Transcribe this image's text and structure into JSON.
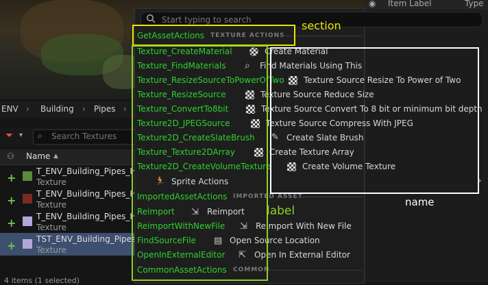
{
  "right_panel": {
    "col1": "Item Label",
    "col2": "Type"
  },
  "breadcrumb": {
    "env": "ENV",
    "sep": "›",
    "building": "Building",
    "pipes": "Pipes"
  },
  "toolbar": {
    "search_placeholder": "Search Textures"
  },
  "column_header": {
    "name": "Name",
    "sort": "▲"
  },
  "assets": [
    {
      "name": "T_ENV_Building_Pipes_Hole",
      "type": "Texture",
      "thumb": "#5a8a3a"
    },
    {
      "name": "T_ENV_Building_Pipes_Hole",
      "type": "Texture",
      "thumb": "#7a2a22"
    },
    {
      "name": "T_ENV_Building_Pipes_Hole",
      "type": "Texture",
      "thumb": "#b0a8d8"
    },
    {
      "name": "TST_ENV_Building_Pipes_",
      "type": "Texture",
      "thumb": "#b0a8d8"
    }
  ],
  "footer": {
    "status": "4 items (1 selected)"
  },
  "menu": {
    "search_placeholder": "Start typing to search",
    "section_texture": {
      "id": "GetAssetActions",
      "title": "TEXTURE ACTIONS"
    },
    "texture_items": [
      {
        "id": "Texture_CreateMaterial",
        "label": "Create Material"
      },
      {
        "id": "Texture_FindMaterials",
        "label": "Find Materials Using This"
      },
      {
        "id": "Texture_ResizeSourceToPowerOfTwo",
        "label": "Texture Source Resize To Power of Two"
      },
      {
        "id": "Texture_ResizeSource",
        "label": "Texture Source Reduce Size"
      },
      {
        "id": "Texture_ConvertTo8bit",
        "label": "Texture Source Convert To 8 bit or minimum bit depth"
      },
      {
        "id": "Texture2D_JPEGSource",
        "label": "Texture Source Compress With JPEG"
      },
      {
        "id": "Texture2D_CreateSlateBrush",
        "label": "Create Slate Brush"
      },
      {
        "id": "Texture_Texture2DArray",
        "label": "Create Texture Array"
      },
      {
        "id": "Texture2D_CreateVolumeTexture",
        "label": "Create Volume Texture"
      }
    ],
    "sprite_actions": "Sprite Actions",
    "section_imported": {
      "id": "ImportedAssetActions",
      "title": "IMPORTED ASSET"
    },
    "imported_items": [
      {
        "id": "Reimport",
        "label": "Reimport"
      },
      {
        "id": "ReimportWithNewFile",
        "label": "Reimport With New File"
      },
      {
        "id": "FindSourceFile",
        "label": "Open Source Location"
      },
      {
        "id": "OpenInExternalEditor",
        "label": "Open In External Editor"
      }
    ],
    "section_common": {
      "id": "CommonAssetActions",
      "title": "COMMON"
    }
  },
  "annotations": {
    "section": "section",
    "label": "label",
    "name": "name",
    "colors": {
      "section": "#e8e800",
      "label": "#8fd12a",
      "name": "#ffffff"
    }
  }
}
